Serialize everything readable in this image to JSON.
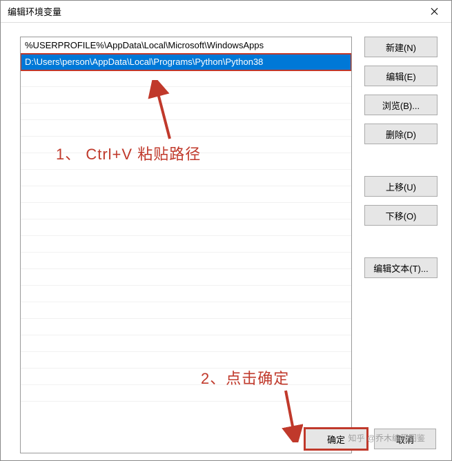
{
  "dialog": {
    "title": "编辑环境变量",
    "close_label": "Close"
  },
  "list": {
    "items": [
      {
        "text": "%USERPROFILE%\\AppData\\Local\\Microsoft\\WindowsApps",
        "selected": false
      },
      {
        "text": "D:\\Users\\person\\AppData\\Local\\Programs\\Python\\Python38",
        "selected": true
      }
    ]
  },
  "buttons": {
    "new": "新建(N)",
    "edit": "编辑(E)",
    "browse": "浏览(B)...",
    "delete": "删除(D)",
    "move_up": "上移(U)",
    "move_down": "下移(O)",
    "edit_text": "编辑文本(T)...",
    "ok": "确定",
    "cancel": "取消"
  },
  "annotations": {
    "step1": "1、 Ctrl+V 粘贴路径",
    "step2": "2、点击确定"
  },
  "watermark": "知乎 @乔木编程图鉴"
}
